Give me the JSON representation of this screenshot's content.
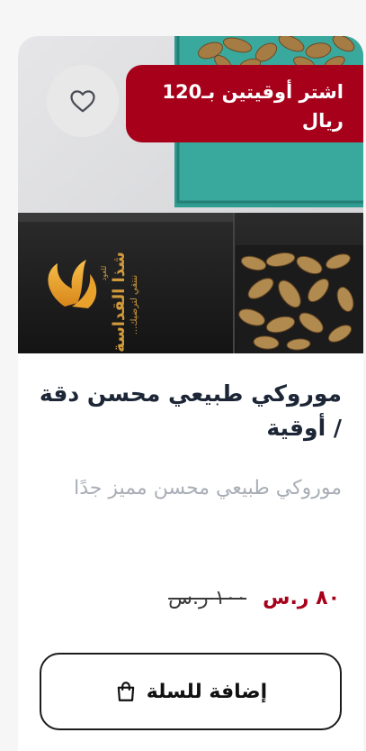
{
  "product": {
    "promo_line1": "اشتر أوقيتين بـ120",
    "promo_line2": "ريال",
    "brand_logo_text": "شذا القداسة",
    "brand_logo_small": "للعود",
    "brand_logo_tagline": "ننتقي لترضيك...",
    "title": "موروكي طبيعي محسن دقة / أوقية",
    "description": "موروكي طبيعي محسن مميز جدًا",
    "price_current": "٨٠ ر.س",
    "price_old": "١٠٠ ر.س",
    "add_to_cart_label": "إضافة للسلة",
    "wishlist_icon": "heart-outline-icon",
    "cart_icon": "shopping-bag-icon"
  },
  "colors": {
    "promo_bg": "#a6001a",
    "price_current": "#a6001a",
    "title": "#1d2636",
    "description": "#a9aeb6"
  }
}
